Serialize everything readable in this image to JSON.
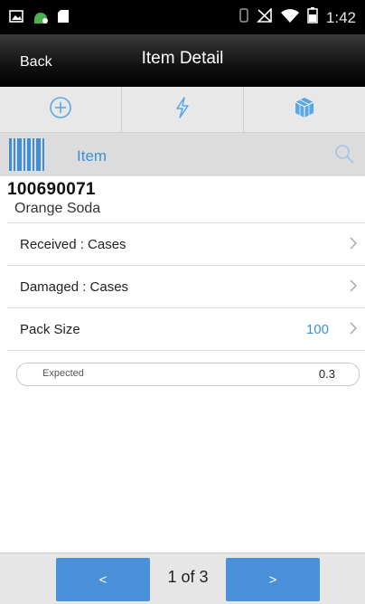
{
  "status_bar": {
    "time": "1:42",
    "left_icons": [
      "image-icon",
      "android-icon",
      "sd-card-icon"
    ],
    "right_icons": [
      "vibrate-icon",
      "no-signal-icon",
      "wifi-icon",
      "battery-icon"
    ]
  },
  "header": {
    "back_label": "Back",
    "title": "Item Detail"
  },
  "toolbar": {
    "icons": [
      "add-circle-icon",
      "lightning-icon",
      "cube-icon"
    ]
  },
  "search": {
    "label": "Item"
  },
  "item": {
    "number": "100690071",
    "description": "Orange Soda"
  },
  "rows": [
    {
      "label": "Received : Cases",
      "value": ""
    },
    {
      "label": "Damaged : Cases",
      "value": ""
    },
    {
      "label": "Pack Size",
      "value": "100"
    }
  ],
  "expected": {
    "label": "Expected",
    "value": "0.3"
  },
  "footer": {
    "prev_label": "<",
    "next_label": ">",
    "page_label": "1 of 3"
  },
  "colors": {
    "accent": "#4a90d9",
    "link_blue": "#3f8fd4",
    "header_bg": "#000000"
  }
}
